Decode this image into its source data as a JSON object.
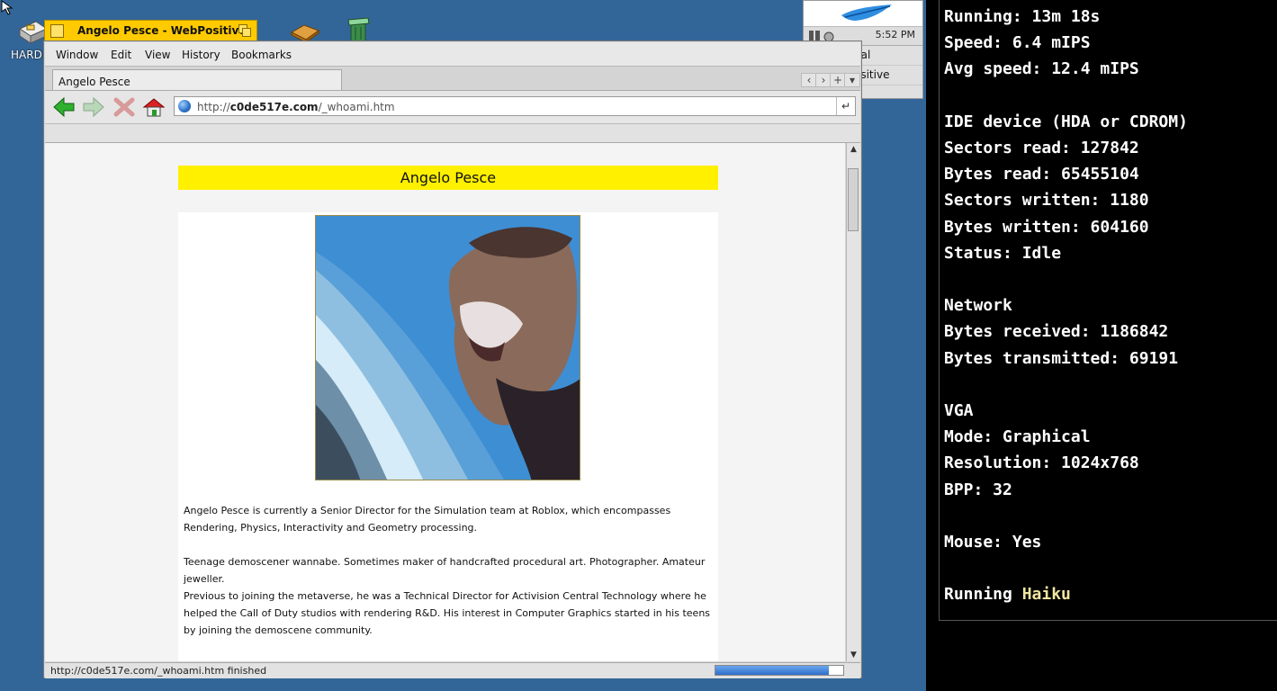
{
  "desktop": {
    "harddisk_label": "HARDD"
  },
  "deskbar": {
    "clock": "5:52 PM",
    "items": [
      "nal",
      "ositive"
    ]
  },
  "window": {
    "title": "Angelo Pesce - WebPositive",
    "menus": [
      "Window",
      "Edit",
      "View",
      "History",
      "Bookmarks"
    ],
    "tab_label": "Angelo Pesce",
    "tab_buttons": [
      "‹",
      "›",
      "+",
      "▾"
    ],
    "url": {
      "prefix": "http://",
      "host": "c0de517e.com",
      "path": "/_whoami.htm"
    },
    "status_text": "http://c0de517e.com/_whoami.htm finished",
    "progress": 0.89
  },
  "page": {
    "header": "Angelo Pesce",
    "paragraphs": [
      "Angelo Pesce is currently a Senior Director for the Simulation team at Roblox, which encompasses Rendering, Physics, Interactivity and Geometry processing.",
      "Teenage demoscener wannabe. Sometimes maker of handcrafted procedural art. Photographer. Amateur jeweller.",
      "Previous to joining the metaverse, he was a Technical Director for Activision Central Technology where he helped the Call of Duty studios with rendering R&D. His interest in Computer Graphics started in his teens by joining the demoscene community."
    ]
  },
  "terminal": {
    "lines": [
      "Running: 13m 18s",
      "Speed: 6.4 mIPS",
      "Avg speed: 12.4 mIPS",
      "",
      "IDE device (HDA or CDROM)",
      "Sectors read: 127842",
      "Bytes read: 65455104",
      "Sectors written: 1180",
      "Bytes written: 604160",
      "Status: Idle",
      "",
      "Network",
      "Bytes received: 1186842",
      "Bytes transmitted: 69191",
      "",
      "VGA",
      "Mode: Graphical",
      "Resolution: 1024x768",
      "BPP: 32",
      "",
      "Mouse: Yes",
      ""
    ],
    "running_prefix": "Running ",
    "running_os": "Haiku"
  },
  "colors": {
    "desktop": "#336698",
    "tab_yellow": "#ffcb00",
    "page_header": "#fff000",
    "terminal_highlight": "#f0e6a0"
  }
}
